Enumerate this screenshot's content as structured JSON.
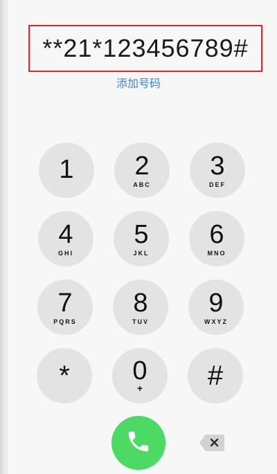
{
  "dialer": {
    "number": "**21*123456789#",
    "add_number_label": "添加号码",
    "accent_color": "#4cd964",
    "highlight_color": "#e0252b",
    "link_color": "#3a86d9",
    "keys": [
      {
        "digit": "1",
        "letters": ""
      },
      {
        "digit": "2",
        "letters": "ABC"
      },
      {
        "digit": "3",
        "letters": "DEF"
      },
      {
        "digit": "4",
        "letters": "GHI"
      },
      {
        "digit": "5",
        "letters": "JKL"
      },
      {
        "digit": "6",
        "letters": "MNO"
      },
      {
        "digit": "7",
        "letters": "PQRS"
      },
      {
        "digit": "8",
        "letters": "TUV"
      },
      {
        "digit": "9",
        "letters": "WXYZ"
      },
      {
        "digit": "*",
        "letters": ""
      },
      {
        "digit": "0",
        "letters": "+"
      },
      {
        "digit": "#",
        "letters": ""
      }
    ],
    "call_icon": "phone-icon",
    "delete_icon": "backspace-icon"
  }
}
